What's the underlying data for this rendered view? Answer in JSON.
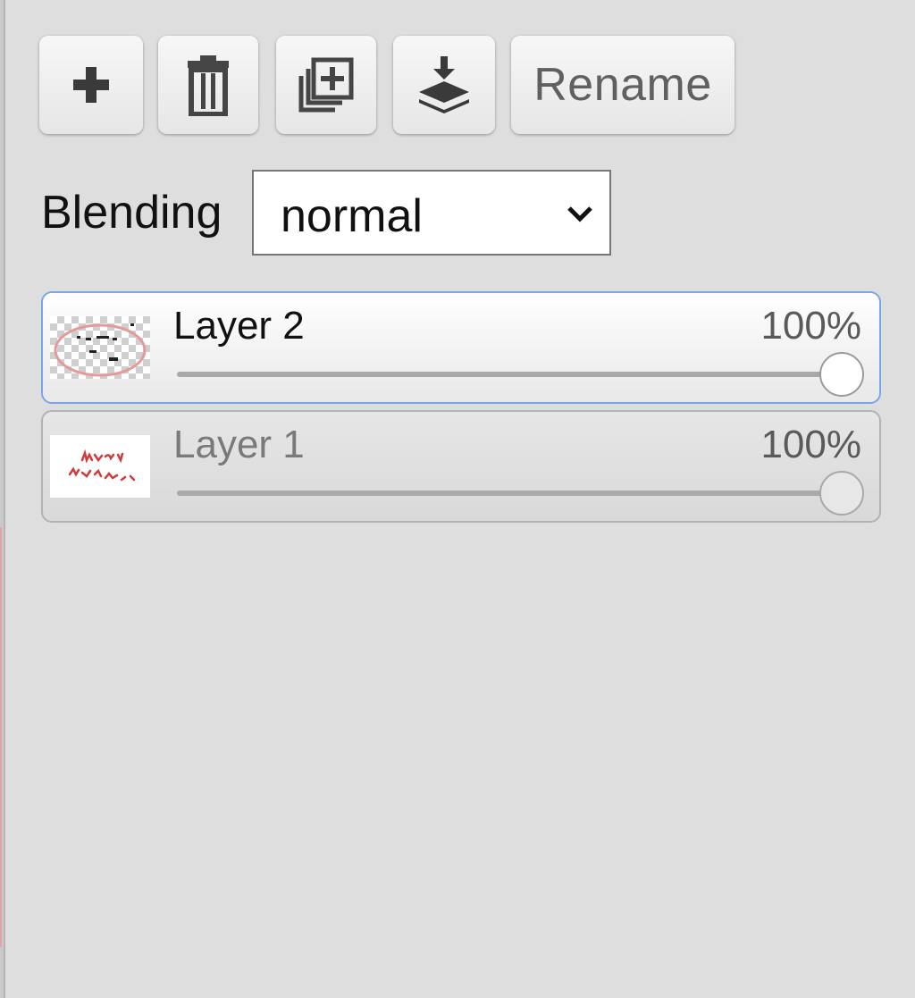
{
  "toolbar": {
    "buttons": [
      {
        "icon": "plus-icon",
        "label": ""
      },
      {
        "icon": "trash-icon",
        "label": ""
      },
      {
        "icon": "duplicate-icon",
        "label": ""
      },
      {
        "icon": "merge-down-icon",
        "label": ""
      },
      {
        "icon": "",
        "label": "Rename"
      }
    ],
    "rename_label": "Rename"
  },
  "blending": {
    "label": "Blending",
    "selected": "normal"
  },
  "layers": [
    {
      "name": "Layer 2",
      "opacity_text": "100%",
      "opacity": 1.0,
      "active": true
    },
    {
      "name": "Layer 1",
      "opacity_text": "100%",
      "opacity": 1.0,
      "active": false
    }
  ],
  "colors": {
    "active_border": "#7aa5e8",
    "panel_bg": "#dedede",
    "thumb_red": "#d23a3a"
  }
}
